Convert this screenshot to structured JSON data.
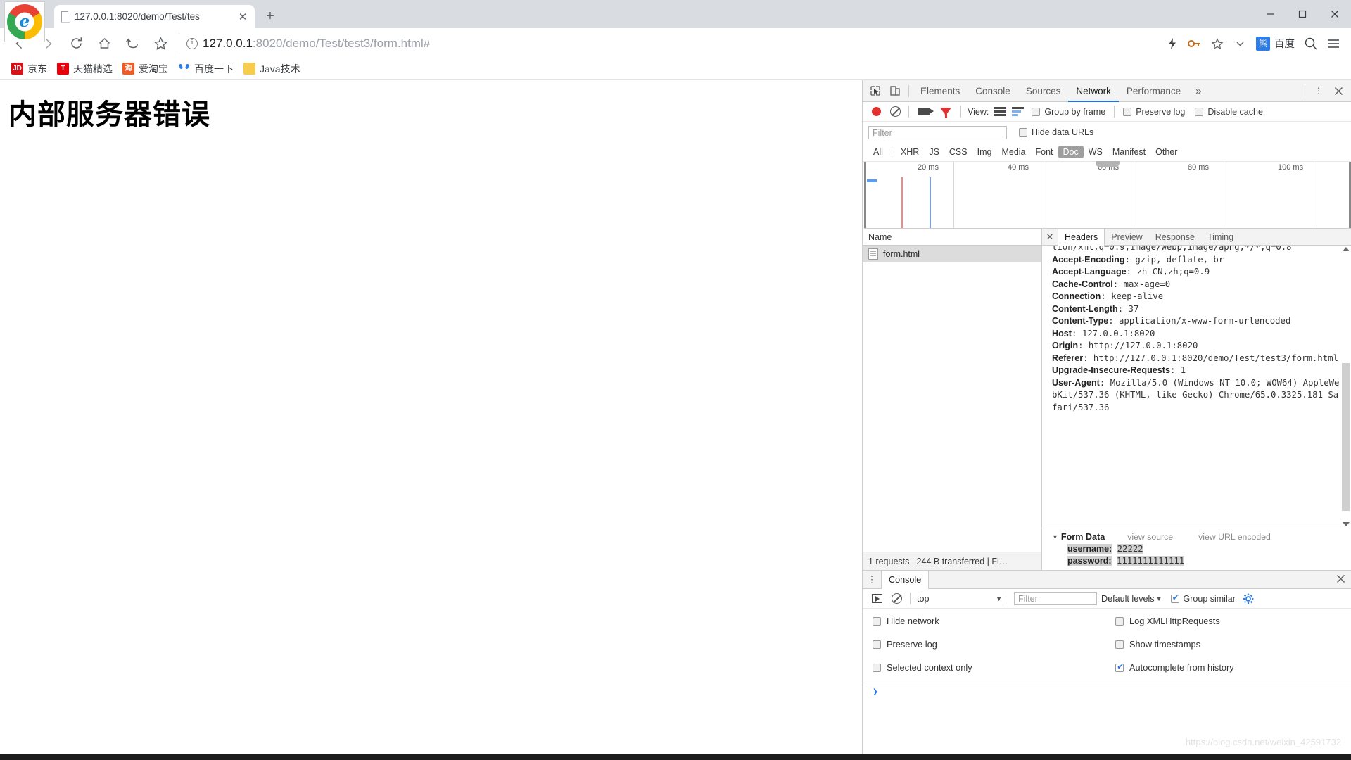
{
  "window": {
    "minimize": "—",
    "maximize": "▢",
    "close": "✕"
  },
  "tabs": [
    {
      "title": "127.0.0.1:8020/demo/Test/tes",
      "close": "✕",
      "favicon": "document-icon"
    }
  ],
  "new_tab_label": "+",
  "toolbar": {
    "back": "back-arrow",
    "forward": "forward-arrow",
    "reload": "reload",
    "home": "home",
    "undo": "undo",
    "bookmark_star": "star",
    "url_prefix": "127.0.0.1",
    "url_rest": ":8020/demo/Test/test3/form.html#",
    "lightning": "⚡",
    "key": "key-icon",
    "star": "☆",
    "chevron": "⌄",
    "baidu_label": "百度",
    "search": "search-icon",
    "menu": "menu-icon"
  },
  "bookmarks": [
    {
      "label": "京东",
      "icon": "jd-icon",
      "icon_text": "JD"
    },
    {
      "label": "天猫精选",
      "icon": "tmall-icon",
      "icon_text": "T"
    },
    {
      "label": "爱淘宝",
      "icon": "taobao-icon",
      "icon_text": "淘"
    },
    {
      "label": "百度一下",
      "icon": "baidu-icon",
      "icon_text": ""
    },
    {
      "label": "Java技术",
      "icon": "folder-icon",
      "icon_text": ""
    }
  ],
  "page": {
    "error_title": "内部服务器错误"
  },
  "devtools": {
    "tabs": [
      {
        "label": "Elements",
        "active": false
      },
      {
        "label": "Console",
        "active": false
      },
      {
        "label": "Sources",
        "active": false
      },
      {
        "label": "Network",
        "active": true
      },
      {
        "label": "Performance",
        "active": false
      }
    ],
    "more": "»",
    "kebab": "⋮",
    "close": "✕",
    "inspect_icon": "inspect-icon",
    "device_icon": "device-toolbar-icon",
    "network": {
      "record": "record-button",
      "clear": "clear-button",
      "capture_screenshots": "camera-button",
      "filter_toggle": "funnel-button",
      "view_label": "View:",
      "view_list": "list-view-icon",
      "view_waterfall": "waterfall-view-icon",
      "group_by_frame": "Group by frame",
      "group_by_frame_checked": false,
      "preserve_log": "Preserve log",
      "preserve_log_checked": false,
      "disable_cache": "Disable cache",
      "disable_cache_checked": false,
      "filter_placeholder": "Filter",
      "filter_value": "",
      "hide_data_urls": "Hide data URLs",
      "hide_data_urls_checked": false,
      "types": [
        "All",
        "XHR",
        "JS",
        "CSS",
        "Img",
        "Media",
        "Font",
        "Doc",
        "WS",
        "Manifest",
        "Other"
      ],
      "active_type": "Doc",
      "timeline_ticks": [
        "20 ms",
        "40 ms",
        "60 ms",
        "80 ms",
        "100 ms"
      ],
      "columns": [
        "Name"
      ],
      "rows": [
        {
          "name": "form.html",
          "icon": "document-icon",
          "selected": true
        }
      ],
      "summary": "1 requests  |  244 B transferred  |  Fi…"
    },
    "detail": {
      "close": "✕",
      "tabs": [
        {
          "label": "Headers",
          "active": true
        },
        {
          "label": "Preview",
          "active": false
        },
        {
          "label": "Response",
          "active": false
        },
        {
          "label": "Timing",
          "active": false
        }
      ],
      "headers_clipped_top": "tion/xml;q=0.9,image/webp,image/apng,*/*;q=0.8",
      "headers": [
        {
          "name": "Accept-Encoding",
          "value": "gzip, deflate, br"
        },
        {
          "name": "Accept-Language",
          "value": "zh-CN,zh;q=0.9"
        },
        {
          "name": "Cache-Control",
          "value": "max-age=0"
        },
        {
          "name": "Connection",
          "value": "keep-alive"
        },
        {
          "name": "Content-Length",
          "value": "37"
        },
        {
          "name": "Content-Type",
          "value": "application/x-www-form-urlencoded"
        },
        {
          "name": "Host",
          "value": "127.0.0.1:8020"
        },
        {
          "name": "Origin",
          "value": "http://127.0.0.1:8020"
        },
        {
          "name": "Referer",
          "value": "http://127.0.0.1:8020/demo/Test/test3/form.html"
        },
        {
          "name": "Upgrade-Insecure-Requests",
          "value": "1"
        },
        {
          "name": "User-Agent",
          "value": "Mozilla/5.0 (Windows NT 10.0; WOW64) AppleWebKit/537.36 (KHTML, like Gecko) Chrome/65.0.3325.181 Safari/537.36"
        }
      ],
      "form_data": {
        "triangle": "▼",
        "title": "Form Data",
        "view_source": "view source",
        "view_url_encoded": "view URL encoded",
        "entries": [
          {
            "key": "username:",
            "value": "22222"
          },
          {
            "key": "password:",
            "value": "1111111111111"
          }
        ]
      }
    },
    "console_drawer": {
      "kebab": "⋮",
      "tab_label": "Console",
      "close": "✕",
      "execute_icon": "execute-icon",
      "clear_icon": "clear-console-icon",
      "context": "top",
      "context_chevron": "▼",
      "filter_placeholder": "Filter",
      "filter_value": "",
      "levels_label": "Default levels",
      "levels_chevron": "▼",
      "group_similar": "Group similar",
      "group_similar_checked": true,
      "settings_icon": "gear-icon",
      "options": [
        {
          "label": "Hide network",
          "checked": false
        },
        {
          "label": "Log XMLHttpRequests",
          "checked": false
        },
        {
          "label": "Preserve log",
          "checked": false
        },
        {
          "label": "Show timestamps",
          "checked": false
        },
        {
          "label": "Selected context only",
          "checked": false
        },
        {
          "label": "Autocomplete from history",
          "checked": true
        }
      ],
      "prompt": "❯"
    }
  },
  "watermark": "https://blog.csdn.net/weixin_42591732",
  "colors": {
    "accent": "#1a73e8",
    "record": "#e13131",
    "selected_row": "#dcdcdc",
    "active_type_bg": "#9e9e9e"
  }
}
